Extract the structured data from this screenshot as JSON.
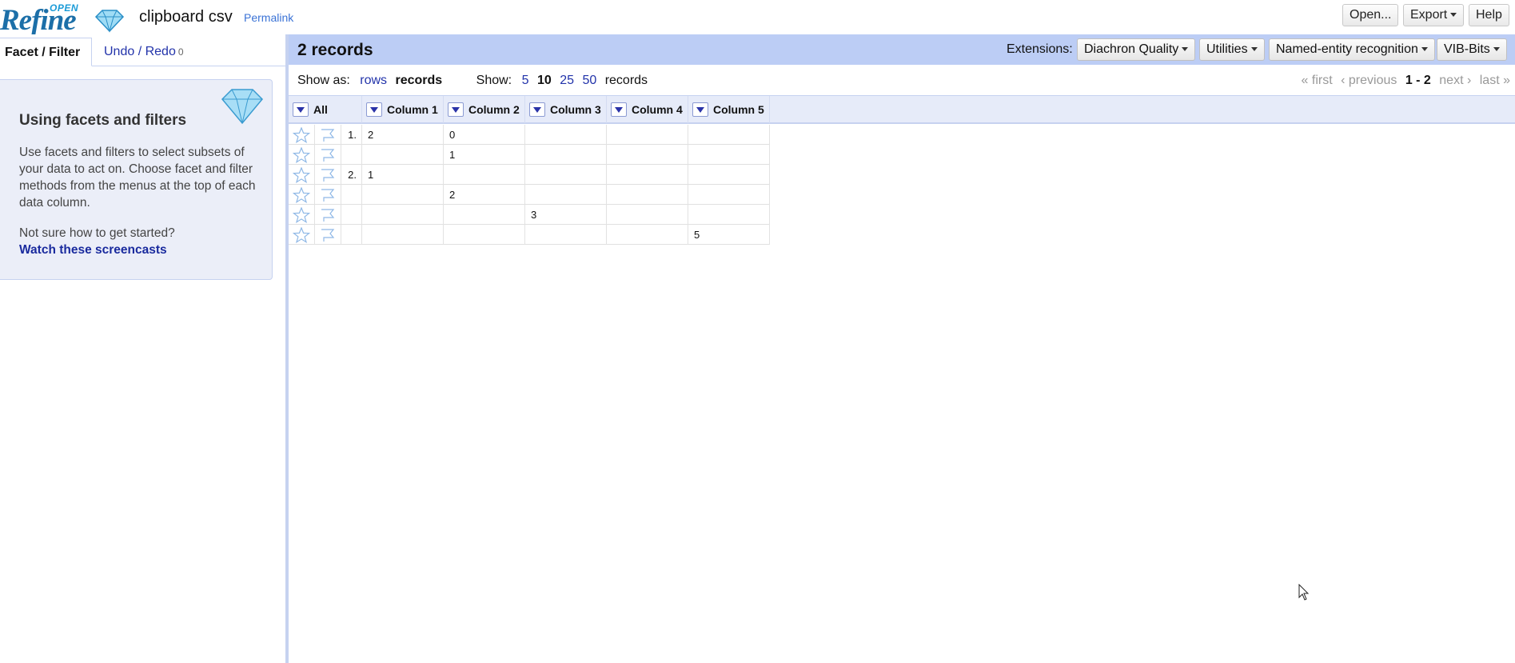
{
  "header": {
    "logo_open": "OPEN",
    "logo_refine": "Refine",
    "project_name": "clipboard csv",
    "permalink": "Permalink",
    "buttons": {
      "open": "Open...",
      "export": "Export",
      "help": "Help"
    }
  },
  "left_panel": {
    "tabs": {
      "facet": "Facet / Filter",
      "undo": "Undo / Redo",
      "undo_count": "0"
    },
    "help": {
      "title": "Using facets and filters",
      "text": "Use facets and filters to select subsets of your data to act on. Choose facet and filter methods from the menus at the top of each data column.",
      "question": "Not sure how to get started?",
      "link": "Watch these screencasts"
    }
  },
  "summary": {
    "record_count": "2 records",
    "extensions_label": "Extensions:",
    "extensions": [
      "Diachron Quality",
      "Utilities",
      "Named-entity recognition",
      "VIB-Bits"
    ]
  },
  "view": {
    "show_as_label": "Show as:",
    "show_as_rows": "rows",
    "show_as_records": "records",
    "show_label": "Show:",
    "page_sizes": [
      "5",
      "10",
      "25",
      "50"
    ],
    "page_size_current": "10",
    "page_size_suffix": "records",
    "pager": {
      "first": "« first",
      "previous": "‹ previous",
      "range": "1 - 2",
      "next": "next ›",
      "last": "last »"
    }
  },
  "table": {
    "all_label": "All",
    "columns": [
      "Column 1",
      "Column 2",
      "Column 3",
      "Column 4",
      "Column 5"
    ],
    "rows": [
      {
        "index": "1.",
        "cells": [
          "2",
          "0",
          "",
          "",
          ""
        ]
      },
      {
        "index": "",
        "cells": [
          "",
          "1",
          "",
          "",
          ""
        ]
      },
      {
        "index": "2.",
        "cells": [
          "1",
          "",
          "",
          "",
          ""
        ]
      },
      {
        "index": "",
        "cells": [
          "",
          "2",
          "",
          "",
          ""
        ]
      },
      {
        "index": "",
        "cells": [
          "",
          "",
          "3",
          "",
          ""
        ]
      },
      {
        "index": "",
        "cells": [
          "",
          "",
          "",
          "",
          "5"
        ]
      }
    ]
  },
  "colors": {
    "accent_band": "#bccdf5",
    "link": "#2233aa",
    "panel_bg": "#ebeef8"
  }
}
